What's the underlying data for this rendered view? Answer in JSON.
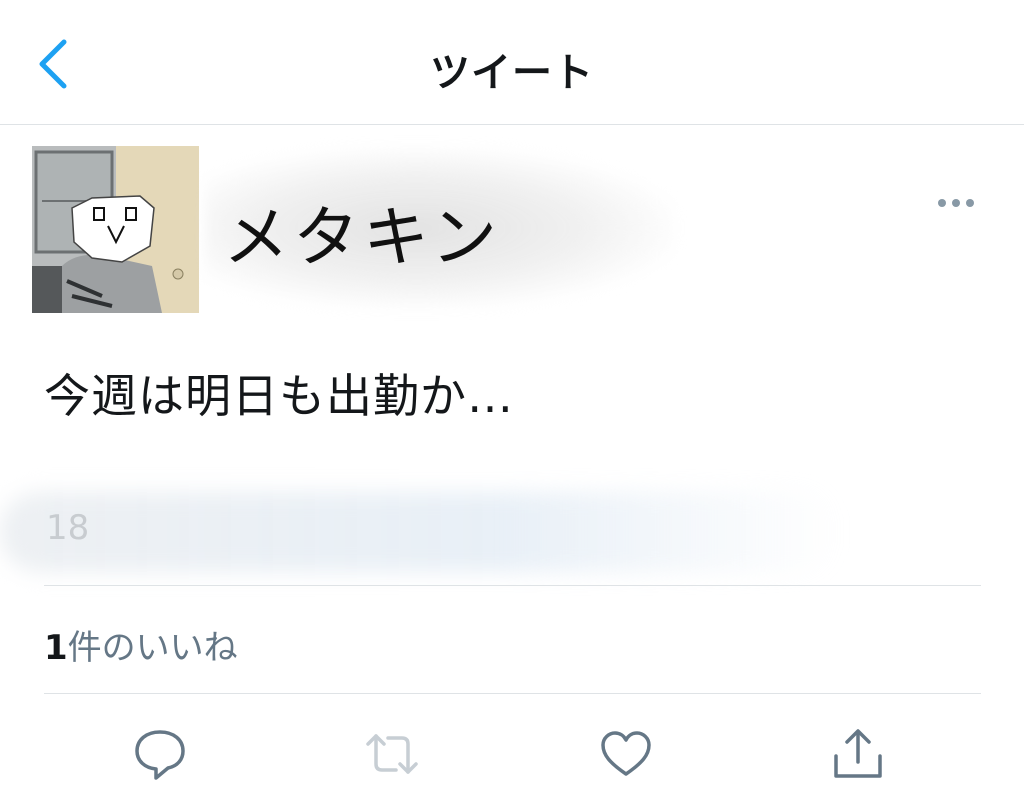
{
  "nav": {
    "title": "ツイート"
  },
  "tweet": {
    "display_name": "メタキン",
    "text": "今週は明日も出勤か…",
    "meta_partial": "18"
  },
  "likes": {
    "count": "1",
    "label": "件のいいね"
  },
  "colors": {
    "accent": "#1da1f2",
    "icon_gray": "#657786",
    "divider": "#dfe3e6"
  }
}
